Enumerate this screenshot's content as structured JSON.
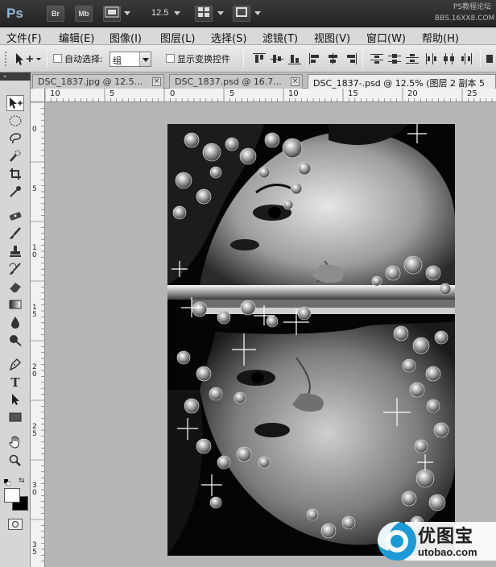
{
  "appbar": {
    "logo": "Ps",
    "bridge_label": "Br",
    "minibridge_label": "Mb",
    "zoom": "12.5",
    "watermark_lines": [
      "PS教程论坛",
      "BBS.16XX8.COM"
    ]
  },
  "menu": [
    "文件(F)",
    "编辑(E)",
    "图像(I)",
    "图层(L)",
    "选择(S)",
    "滤镜(T)",
    "视图(V)",
    "窗口(W)",
    "帮助(H)"
  ],
  "options": {
    "auto_select_label": "自动选择:",
    "auto_select_value": "组",
    "show_transform_label": "显示变换控件"
  },
  "tabs": [
    {
      "label": "DSC_1837.jpg @ 12.5..."
    },
    {
      "label": "DSC_1837.psd @ 16.7..."
    },
    {
      "label": "DSC_1837-.psd @ 12.5% (图层 2 副本 5"
    }
  ],
  "hruler": [
    "10",
    "5",
    "0",
    "5",
    "10",
    "15",
    "20",
    "25"
  ],
  "vruler": [
    "0",
    "5",
    "1\n0",
    "1\n5",
    "2\n0",
    "2\n5",
    "3\n0",
    "3\n5"
  ],
  "tools": [
    "move-icon",
    "marquee-icon",
    "lasso-icon",
    "quick-select-icon",
    "crop-icon",
    "eyedropper-icon",
    "healing-icon",
    "brush-icon",
    "stamp-icon",
    "history-brush-icon",
    "eraser-icon",
    "gradient-icon",
    "blur-icon",
    "dodge-icon",
    "pen-icon",
    "type-icon",
    "path-select-icon",
    "shape-icon",
    "hand-icon",
    "zoom-icon"
  ],
  "logo": {
    "name": "优图宝",
    "url": "utobao.com"
  },
  "colors": {
    "canvas_bg": "#b5b5b5",
    "logo_blue": "#1c9ad6"
  }
}
